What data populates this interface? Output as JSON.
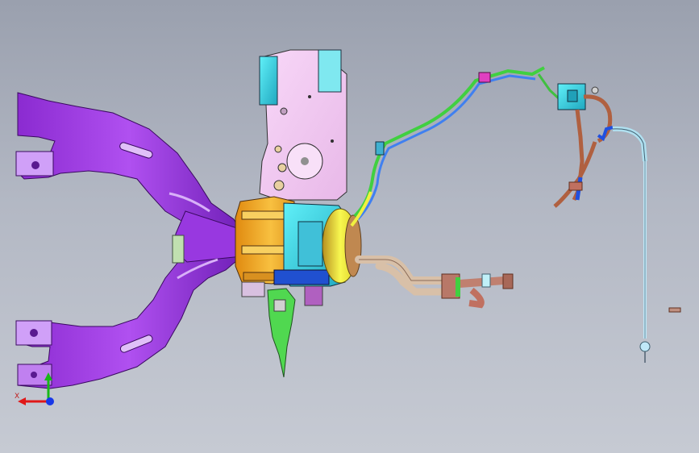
{
  "viewport": {
    "background_top": "#9aa0ae",
    "background_bottom": "#c6cad3"
  },
  "triad": {
    "x_label": "X",
    "x_color": "#e01818",
    "y_color": "#18b818",
    "z_color": "#1838e8"
  },
  "colors": {
    "crossmember": "#a040e0",
    "crossmember_dark": "#6a1aa8",
    "crossmember_light": "#c890f0",
    "block": "#f0c8f0",
    "block_outline": "#303030",
    "housing_cyan": "#30d0e0",
    "housing_orange": "#f0a020",
    "housing_yellow": "#f0f040",
    "housing_brown": "#c8a040",
    "bracket_green": "#40d040",
    "hose_green": "#60e060",
    "hose_blue": "#2050e0",
    "hose_brown": "#b06040",
    "hose_pink": "#e040c0",
    "pipe_tan": "#e0c0a0",
    "pipe_copper": "#b87868",
    "rod_cyan": "#b0e0f0"
  }
}
